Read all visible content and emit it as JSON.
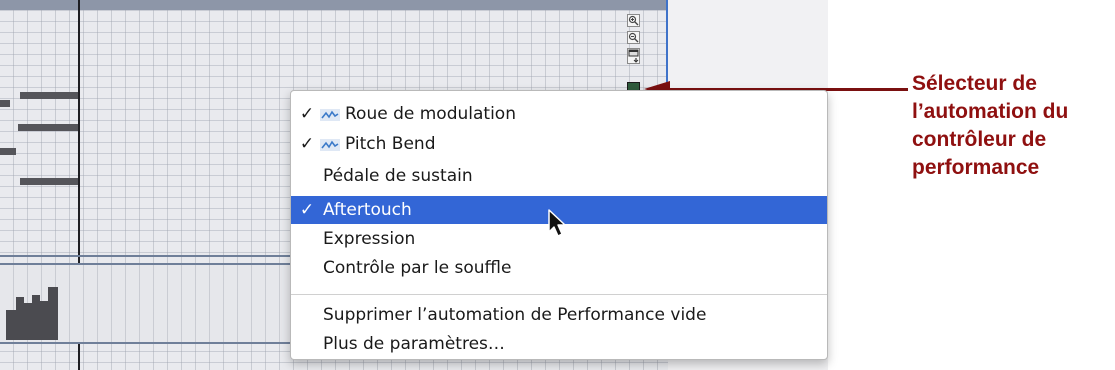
{
  "editor": {
    "zoom_in_icon": "zoom-in-icon",
    "zoom_out_icon": "zoom-out-icon",
    "fit_icon": "fit-view-icon",
    "automation_selector_icon": "automation-selector-icon"
  },
  "menu": {
    "items": [
      {
        "label": "Roue de modulation",
        "checked": true,
        "icon": "automation-curve-icon"
      },
      {
        "label": "Pitch Bend",
        "checked": true,
        "icon": "automation-curve-icon"
      },
      {
        "label": "Pédale de sustain",
        "checked": false
      },
      {
        "label": "Aftertouch",
        "checked": true,
        "selected": true
      },
      {
        "label": "Expression",
        "checked": false
      },
      {
        "label": "Contrôle par le souffle",
        "checked": false
      }
    ],
    "actions": [
      {
        "label": "Supprimer l’automation de Performance vide"
      },
      {
        "label": "Plus de paramètres…"
      }
    ],
    "check_glyph": "✓",
    "selection_color": "#3366d6"
  },
  "callout": {
    "lines": [
      "Sélecteur de",
      "l’automation du",
      "contrôleur de",
      "performance"
    ],
    "color": "#8f1010"
  }
}
